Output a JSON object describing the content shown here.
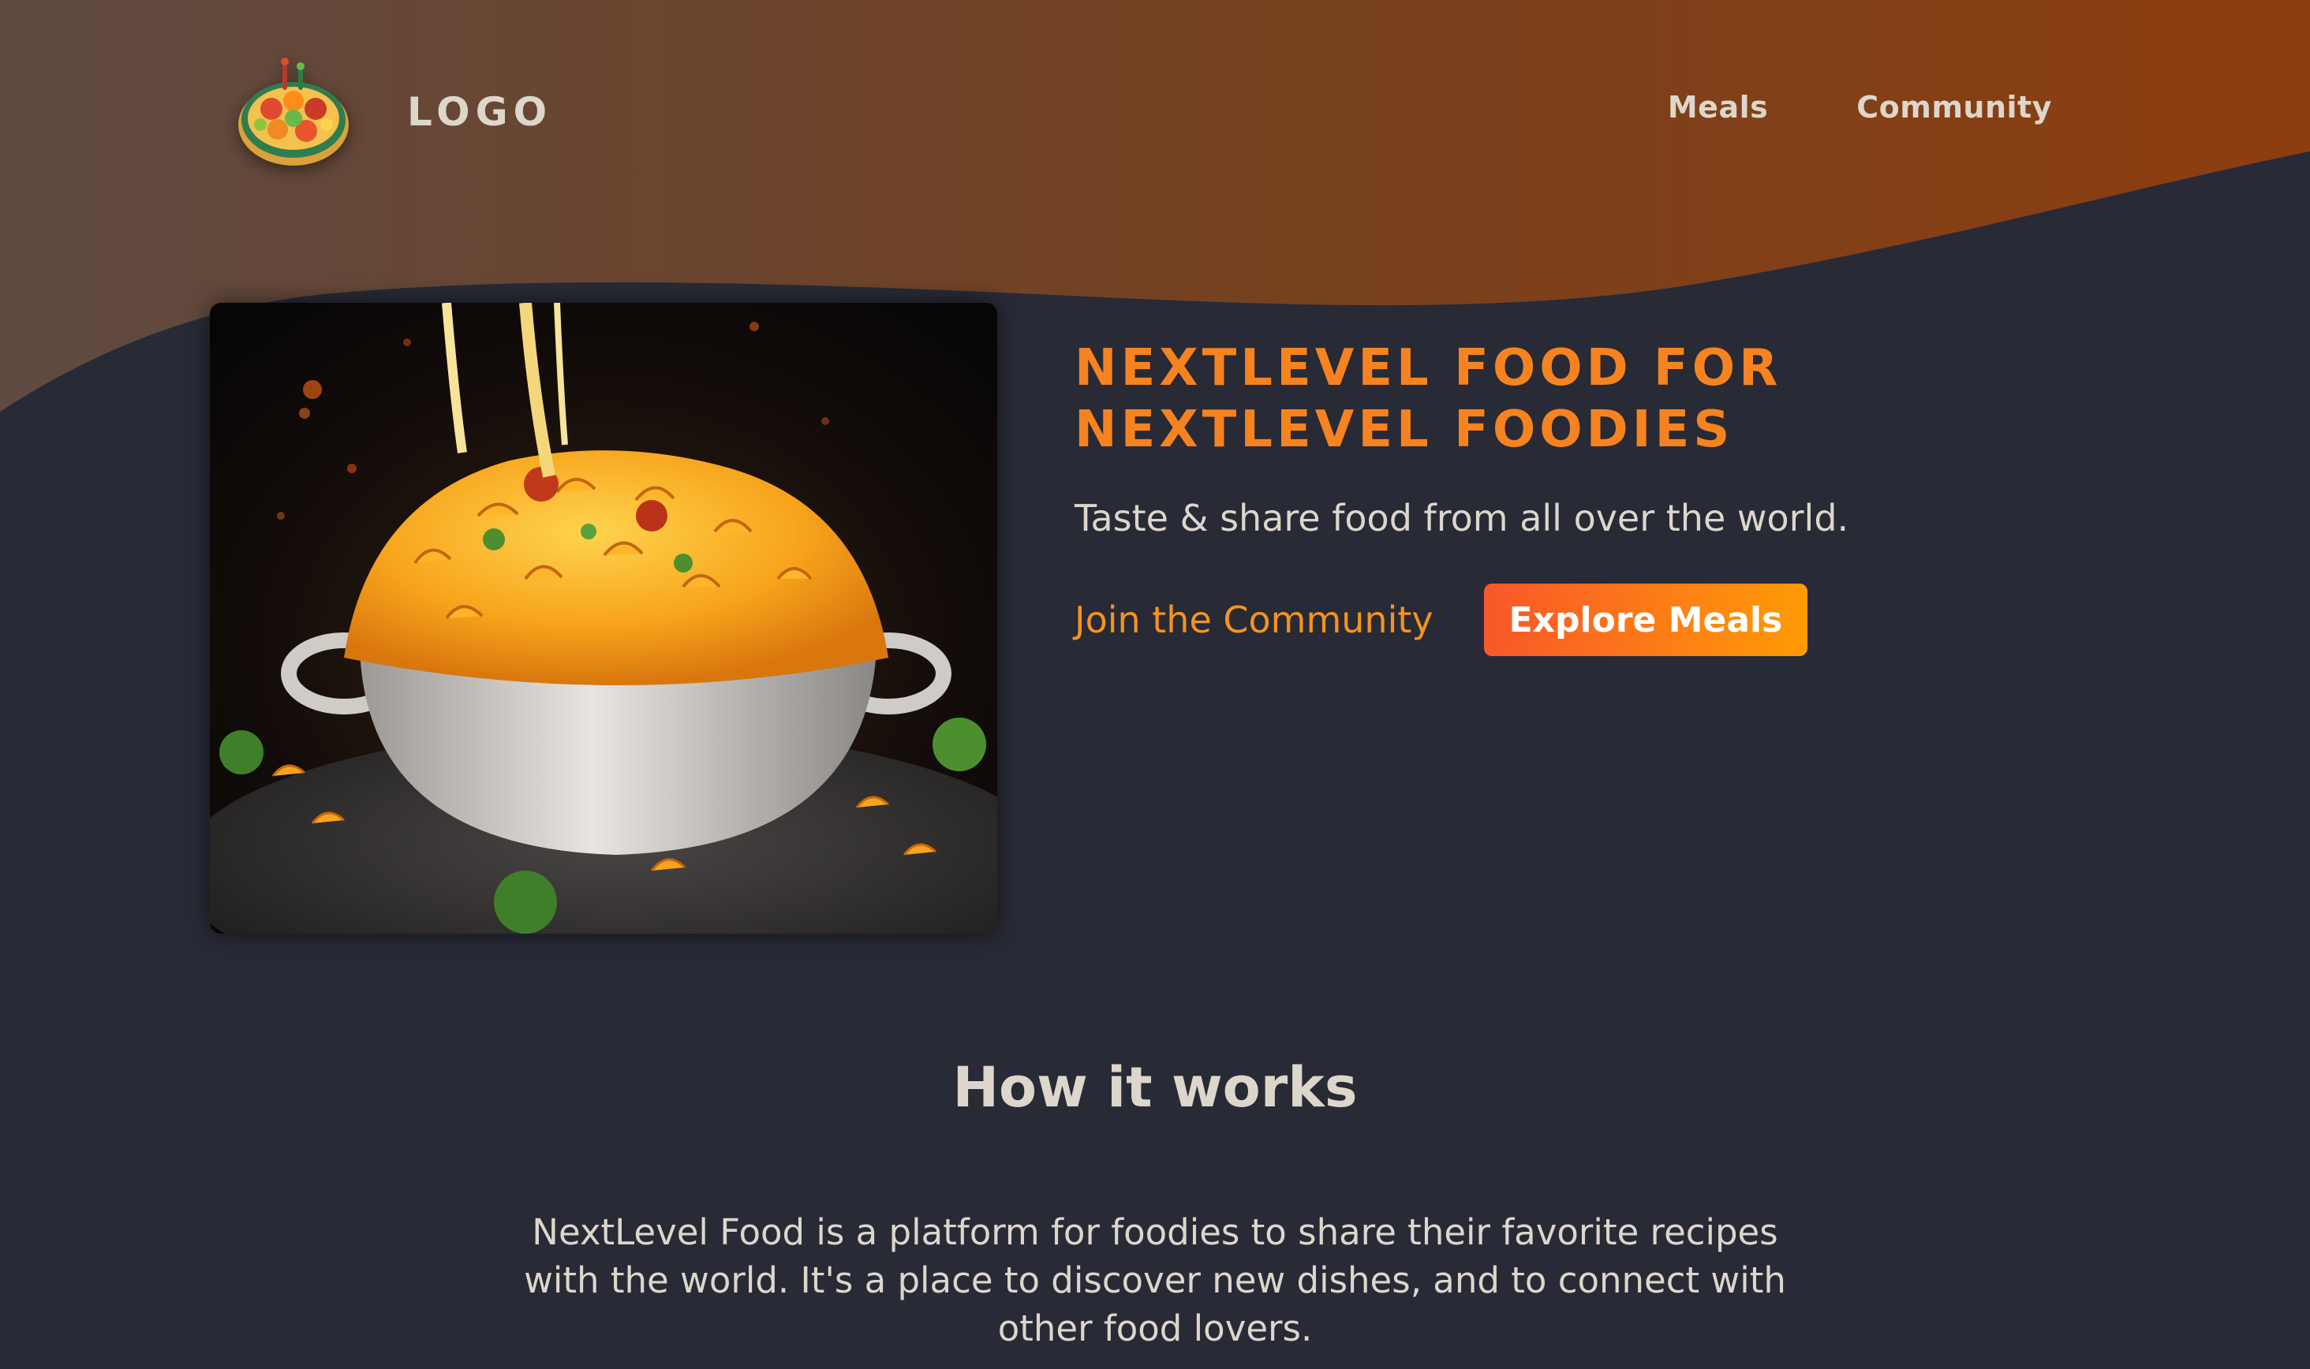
{
  "header": {
    "logo_text": "LOGO",
    "nav": [
      {
        "label": "Meals"
      },
      {
        "label": "Community"
      }
    ]
  },
  "hero": {
    "title_line1": "NEXTLEVEL FOOD FOR",
    "title_line2": "NEXTLEVEL FOODIES",
    "subtitle": "Taste & share food from all over the world.",
    "join_label": "Join the Community",
    "explore_label": "Explore Meals"
  },
  "how_it_works": {
    "title": "How it works",
    "text": "NextLevel Food is a platform for foodies to share their favorite recipes with the world. It's a place to discover new dishes, and to connect with other food lovers."
  },
  "colors": {
    "background": "#282a36",
    "header_gradient_start": "#5f4a42",
    "header_gradient_end": "#8d3e10",
    "accent_orange": "#f6831f",
    "button_gradient_start": "#f9572a",
    "button_gradient_end": "#ff9b05",
    "text_light": "#ddd6cb"
  },
  "icons": {
    "logo": "food-platter-icon"
  }
}
